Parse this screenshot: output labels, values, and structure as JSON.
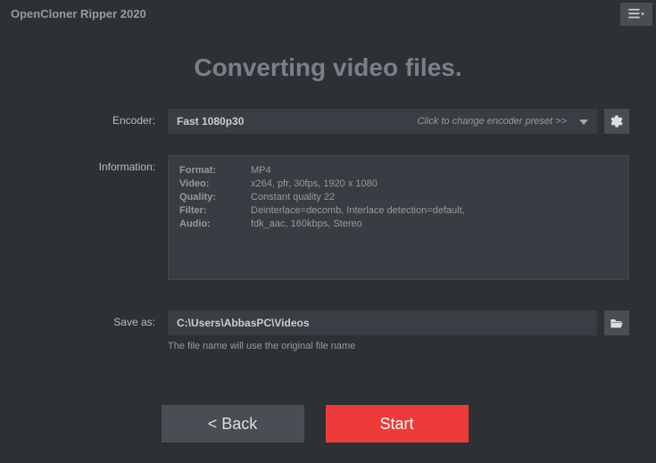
{
  "app_title": "OpenCloner Ripper 2020",
  "heading": "Converting video files.",
  "labels": {
    "encoder": "Encoder:",
    "information": "Information:",
    "saveas": "Save as:"
  },
  "encoder": {
    "preset": "Fast 1080p30",
    "hint": "Click to change encoder preset >>"
  },
  "info": {
    "format_k": "Format:",
    "format_v": "MP4",
    "video_k": "Video:",
    "video_v": "x264, pfr, 30fps, 1920 x 1080",
    "quality_k": "Quality:",
    "quality_v": "Constant quality 22",
    "filter_k": "Filter:",
    "filter_v": "Deinterlace=decomb, Interlace detection=default,",
    "audio_k": "Audio:",
    "audio_v": "fdk_aac, 160kbps, Stereo"
  },
  "saveas": {
    "path": "C:\\Users\\AbbasPC\\Videos",
    "note": "The file name will use the original file name"
  },
  "buttons": {
    "back": "<   Back",
    "start": "Start"
  }
}
